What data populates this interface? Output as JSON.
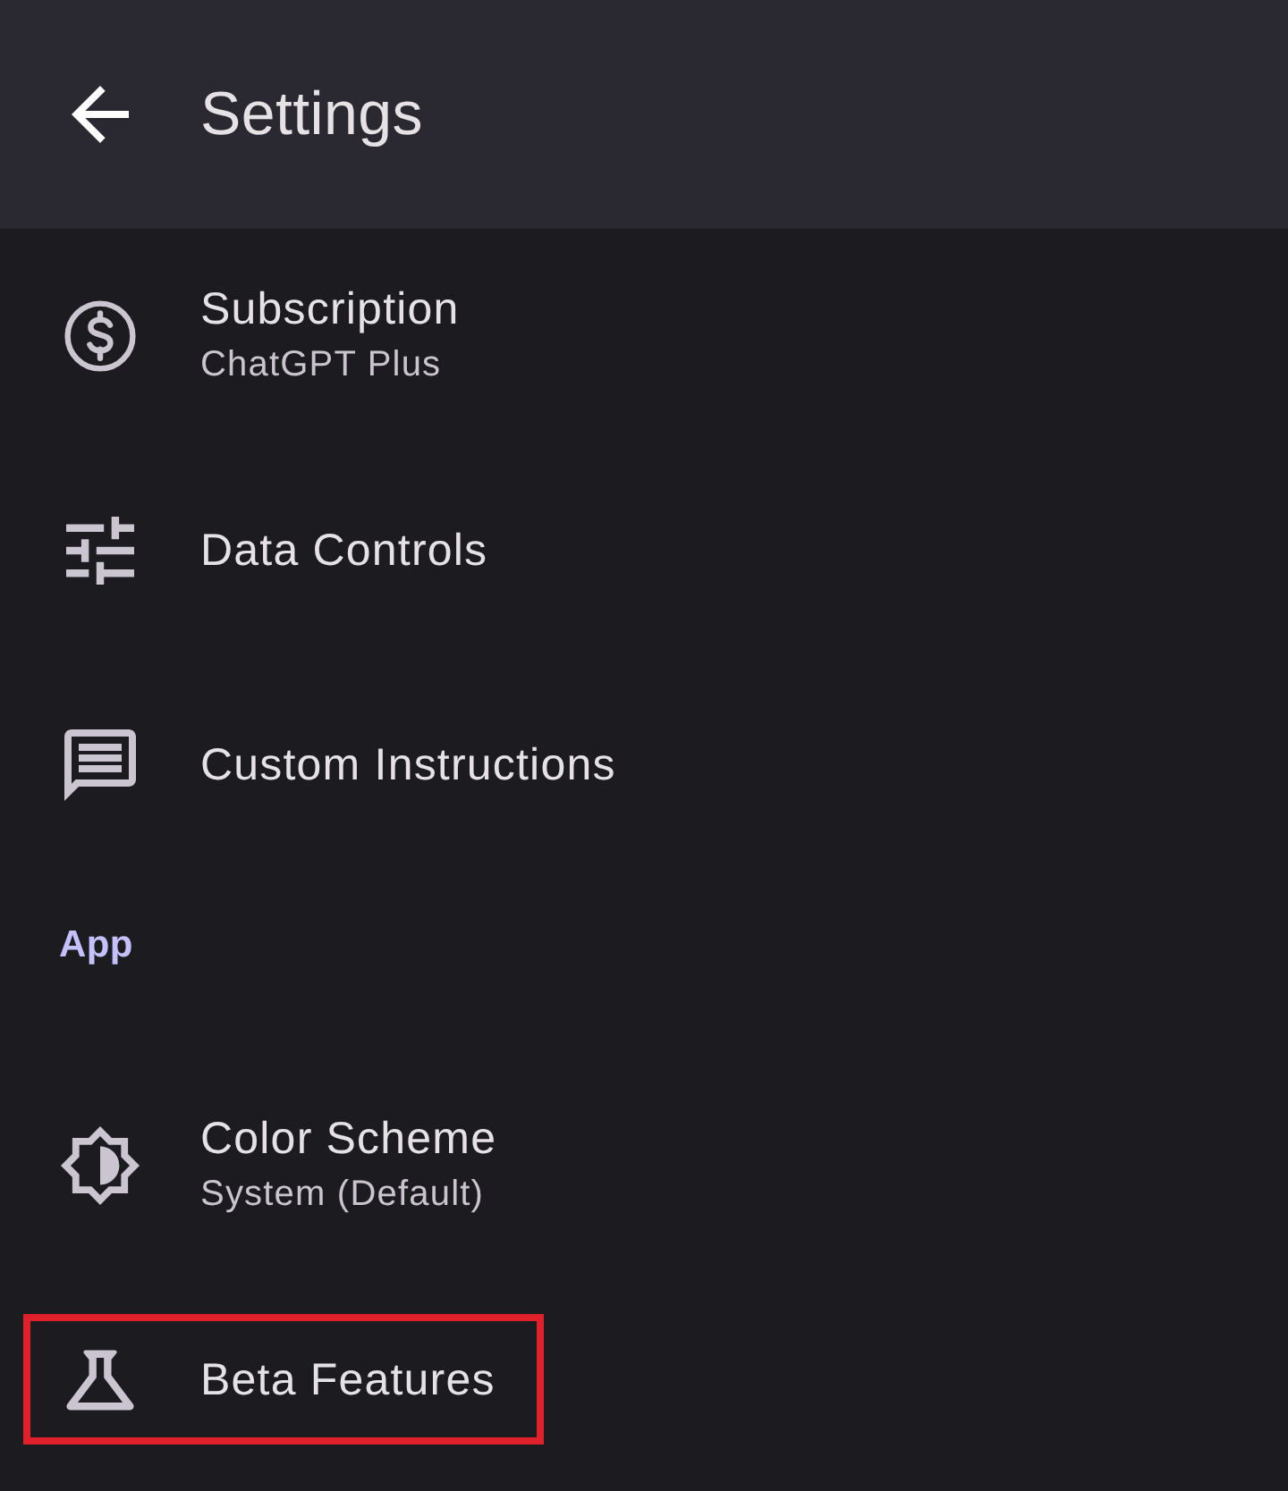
{
  "header": {
    "title": "Settings"
  },
  "list": [
    {
      "kind": "row",
      "title": "Subscription",
      "subtitle": "ChatGPT Plus",
      "highlighted": false
    },
    {
      "kind": "row",
      "title": "Data Controls",
      "highlighted": false
    },
    {
      "kind": "row",
      "title": "Custom Instructions",
      "highlighted": false
    },
    {
      "kind": "section",
      "label": "App"
    },
    {
      "kind": "row",
      "title": "Color Scheme",
      "subtitle": "System (Default)",
      "highlighted": false
    },
    {
      "kind": "row",
      "title": "Beta Features",
      "highlighted": true
    }
  ]
}
